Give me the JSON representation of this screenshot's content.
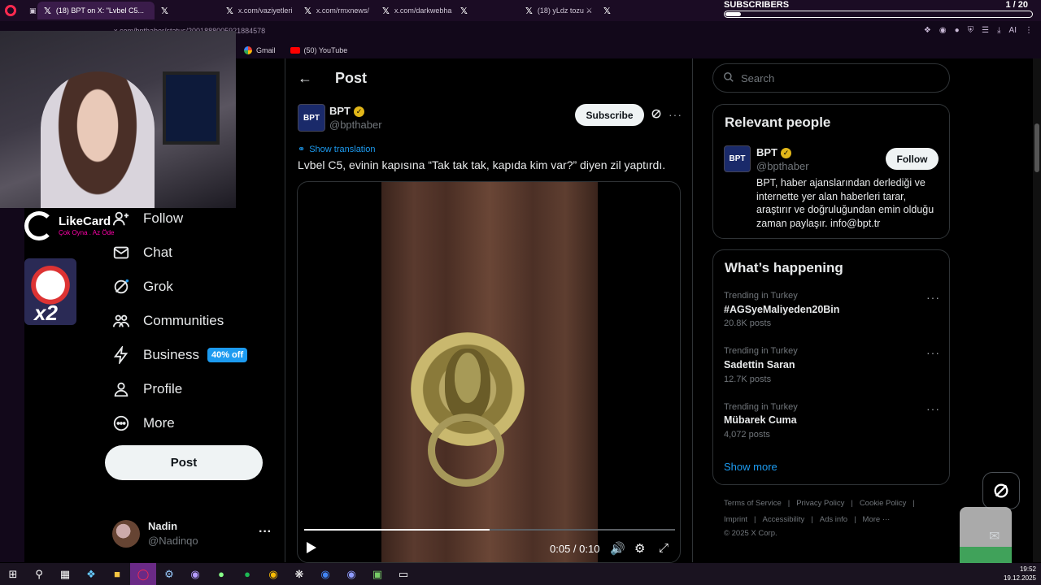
{
  "browser": {
    "tabs": [
      {
        "label": "(18) BPT on X: \"Lvbel C5...",
        "active": true
      },
      {
        "label": "X",
        "active": false
      },
      {
        "label": "x.com/vaziyetleri",
        "active": false
      },
      {
        "label": "x.com/rmxnews/",
        "active": false
      },
      {
        "label": "x.com/darkwebha",
        "active": false
      },
      {
        "label": "X",
        "active": false
      },
      {
        "label": "(18) yLdz tozu ⚔",
        "active": false
      },
      {
        "label": "X",
        "active": false
      }
    ],
    "url": "x.com/bpthaber/status/2001888005921884578",
    "bookmarks": [
      {
        "label": "Gmail",
        "icon": "google-icon"
      },
      {
        "label": "(50) YouTube",
        "icon": "youtube-icon"
      }
    ],
    "extensions_text": "AI"
  },
  "overlay": {
    "subscribers_label": "SUBSCRIBERS",
    "subscribers_count": "1 / 20",
    "subscribers_progress": 0.05,
    "likecard_name": "LikeCard",
    "likecard_slogan": "Çok Oyna . Az Öde",
    "multiplier": "x2"
  },
  "nav": {
    "items": [
      {
        "label": "Follow",
        "icon": "follow-icon"
      },
      {
        "label": "Chat",
        "icon": "mail-icon"
      },
      {
        "label": "Grok",
        "icon": "grok-icon"
      },
      {
        "label": "Communities",
        "icon": "communities-icon"
      },
      {
        "label": "Business",
        "icon": "lightning-icon",
        "badge": "40% off"
      },
      {
        "label": "Profile",
        "icon": "person-icon"
      },
      {
        "label": "More",
        "icon": "more-circle-icon"
      }
    ],
    "post_label": "Post",
    "me_name": "Nadin",
    "me_handle": "@Nadinqo"
  },
  "post": {
    "header_title": "Post",
    "author_name": "BPT",
    "author_handle": "@bpthaber",
    "subscribe_label": "Subscribe",
    "translate_label": "Show translation",
    "text": "Lvbel C5, evinin kapısına “Tak tak tak, kapıda kim var?” diyen zil yaptırdı.",
    "video": {
      "time": "0:05 / 0:10",
      "progress": 0.5
    },
    "logo_text": "BPT"
  },
  "right": {
    "search_placeholder": "Search",
    "relevant_title": "Relevant people",
    "person_name": "BPT",
    "person_handle": "@bpthaber",
    "follow_label": "Follow",
    "bio": "BPT, haber ajanslarından derlediği ve internette yer alan haberleri tarar, araştırır ve doğruluğundan emin olduğu zaman paylaşır. info@bpt.tr",
    "happening_title": "What’s happening",
    "trends": [
      {
        "meta": "Trending in Turkey",
        "name": "#AGSyeMaliyeden20Bin",
        "posts": "20.8K posts"
      },
      {
        "meta": "Trending in Turkey",
        "name": "Sadettin Saran",
        "posts": "12.7K posts"
      },
      {
        "meta": "Trending in Turkey",
        "name": "Mübarek Cuma",
        "posts": "4,072 posts"
      }
    ],
    "show_more": "Show more",
    "footer_row1": [
      "Terms of Service",
      "|",
      "Privacy Policy",
      "|",
      "Cookie Policy",
      "|"
    ],
    "footer_row2": [
      "Imprint",
      "|",
      "Accessibility",
      "|",
      "Ads info",
      "|",
      "More ···"
    ],
    "copyright": "© 2025 X Corp."
  },
  "taskbar": {
    "time": "19:52",
    "date": "19.12.2025"
  },
  "colors": {
    "accent": "#1d9bf0",
    "verified": "#e2b719",
    "chrome": "#1b0c24"
  }
}
